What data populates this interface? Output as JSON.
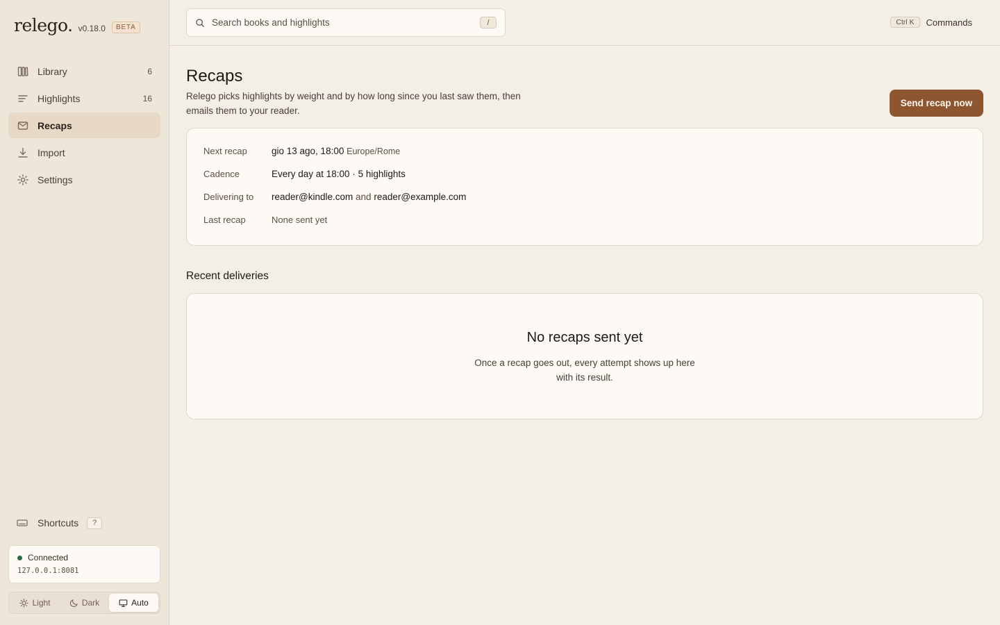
{
  "brand": {
    "logo": "relego.",
    "version": "v0.18.0",
    "badge": "BETA"
  },
  "sidebar": {
    "items": [
      {
        "label": "Library",
        "count": "6",
        "icon": "library-icon"
      },
      {
        "label": "Highlights",
        "count": "16",
        "icon": "highlights-icon"
      },
      {
        "label": "Recaps",
        "count": "",
        "icon": "mail-icon",
        "active": true
      },
      {
        "label": "Import",
        "count": "",
        "icon": "download-icon"
      },
      {
        "label": "Settings",
        "count": "",
        "icon": "gear-icon"
      }
    ],
    "shortcuts": {
      "label": "Shortcuts",
      "key": "?"
    },
    "connection": {
      "status": "Connected",
      "address": "127.0.0.1:8081",
      "status_color": "#2d6a48"
    },
    "theme": {
      "options": [
        "Light",
        "Dark",
        "Auto"
      ],
      "selected": "Auto"
    }
  },
  "topbar": {
    "search": {
      "placeholder": "Search books and highlights",
      "value": "",
      "key": "/"
    },
    "commands": {
      "key": "Ctrl K",
      "label": "Commands"
    }
  },
  "page": {
    "title": "Recaps",
    "description": "Relego picks highlights by weight and by how long since you last saw them, then emails them to your reader.",
    "primary_button": "Send recap now",
    "accent_color": "#8e5630"
  },
  "recap_info": {
    "next_recap": {
      "label": "Next recap",
      "value": "gio 13 ago, 18:00",
      "timezone": "Europe/Rome"
    },
    "cadence": {
      "label": "Cadence",
      "value": "Every day at 18:00 · 5 highlights"
    },
    "delivering_to": {
      "label": "Delivering to",
      "email1": "reader@kindle.com",
      "joiner": "and",
      "email2": "reader@example.com"
    },
    "last_recap": {
      "label": "Last recap",
      "value": "None sent yet"
    }
  },
  "deliveries": {
    "title": "Recent deliveries",
    "empty_title": "No recaps sent yet",
    "empty_description": "Once a recap goes out, every attempt shows up here with its result."
  }
}
